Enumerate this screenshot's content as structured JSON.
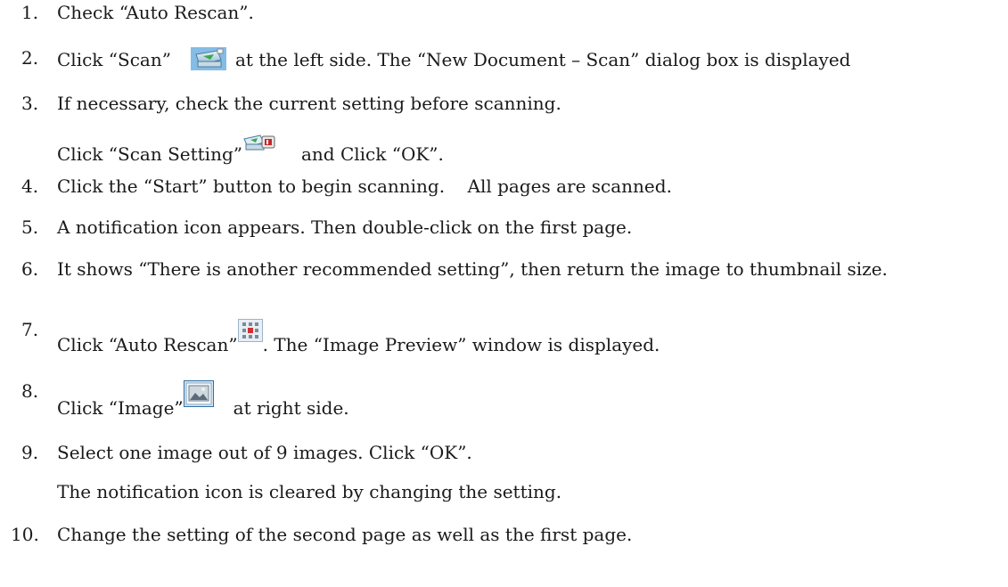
{
  "steps": [
    {
      "number": "1.",
      "text": "Check “Auto Rescan”."
    },
    {
      "number": "2.",
      "before": "Click “Scan”",
      "icon": "scanner-icon",
      "after": "at the left side. The “New Document – Scan” dialog box is displayed"
    },
    {
      "number": "3.",
      "text": "If necessary, check the current setting before scanning.",
      "line2_before": "Click “Scan Setting”",
      "icon": "scan-setting-icon",
      "line2_after": "and Click “OK”."
    },
    {
      "number": "4.",
      "text": "Click the “Start” button to begin scanning.    All pages are scanned."
    },
    {
      "number": "5.",
      "text": "A notification icon appears. Then double-click on the first page."
    },
    {
      "number": "6.",
      "text": "It shows “There is another recommended setting”, then return the image to thumbnail size."
    },
    {
      "number": "7.",
      "before": "Click “Auto Rescan”",
      "icon": "auto-rescan-grid-icon",
      "after": ". The “Image Preview” window is displayed."
    },
    {
      "number": "8.",
      "before": "Click “Image”",
      "icon": "image-icon",
      "after": "at right side."
    },
    {
      "number": "9.",
      "text": "Select one image out of 9 images. Click “OK”.",
      "line2": "The notification icon is cleared by changing the setting."
    },
    {
      "number": "10.",
      "text": "Change the setting of the second page as well as the first page."
    }
  ]
}
